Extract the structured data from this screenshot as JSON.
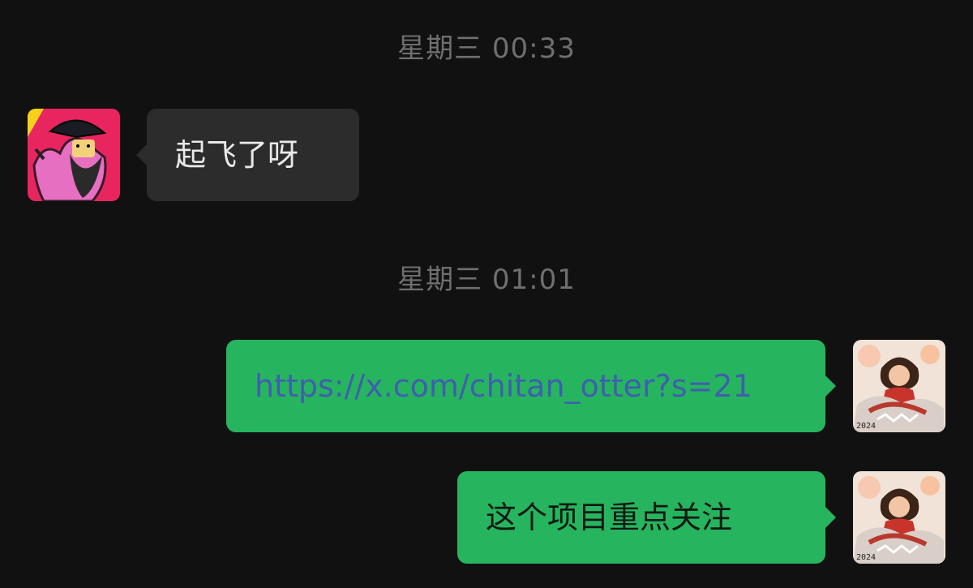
{
  "timestamps": [
    "星期三 00:33",
    "星期三 01:01"
  ],
  "messages": [
    {
      "direction": "incoming",
      "text": "起飞了呀"
    },
    {
      "direction": "outgoing",
      "text": "https://x.com/chitan_otter?s=21",
      "is_link": true
    },
    {
      "direction": "outgoing",
      "text": "这个项目重点关注"
    }
  ],
  "avatars": {
    "contact": "contact-avatar",
    "self": "self-avatar",
    "self_overlay_text": "2024"
  },
  "colors": {
    "background": "#111111",
    "incoming_bubble": "#2c2c2c",
    "outgoing_bubble": "#27b45f",
    "timestamp": "#6f6f6f",
    "link": "#3f5fae"
  }
}
